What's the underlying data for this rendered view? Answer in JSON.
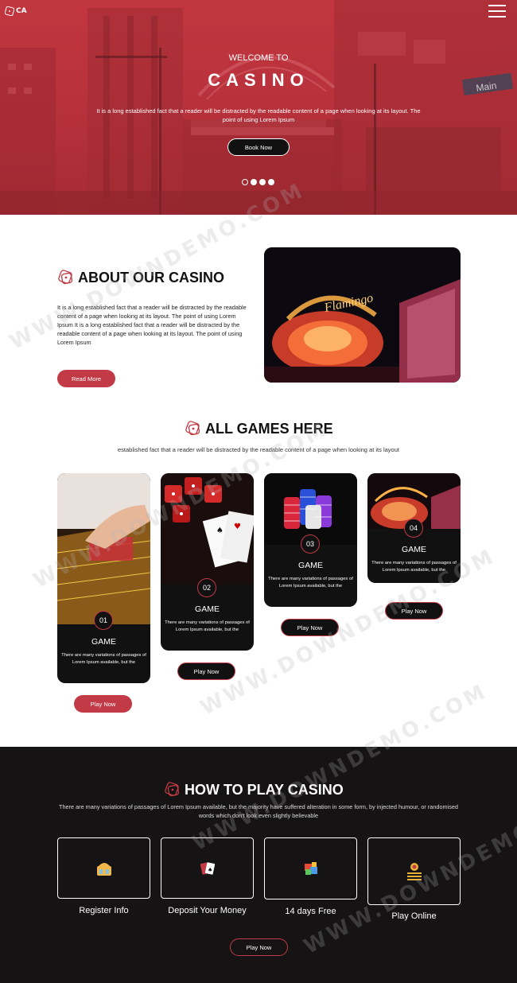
{
  "header": {
    "logo_text": "CA",
    "welcome": "WELCOME TO",
    "title": "CASINO",
    "text": "It is a long established fact that a reader will be distracted by the readable content of a page when looking at its layout. The point of using Lorem Ipsum",
    "book_button": "Book Now",
    "slides": 4,
    "active_slide": 1
  },
  "about": {
    "title": "ABOUT OUR CASINO",
    "paragraph": "It is a long established fact that a reader will be distracted by the readable content of a page when looking at its layout. The point of using Lorem Ipsum It is a long established fact that a reader will be distracted by the readable content of a page when looking at its layout. The point of using Lorem Ipsum",
    "button": "Read More"
  },
  "games": {
    "title": "ALL GAMES HERE",
    "subtitle": "established fact that a reader will be distracted by the readable content of a page when looking at its layout",
    "cards": [
      {
        "number": "01",
        "title": "GAME",
        "desc": "There are many variations of passages of Lorem Ipsum available, but the",
        "button": "Play Now"
      },
      {
        "number": "02",
        "title": "GAME",
        "desc": "There are many variations of passages of Lorem Ipsum available, but the",
        "button": "Play Now"
      },
      {
        "number": "03",
        "title": "GAME",
        "desc": "There are many variations of passages of Lorem Ipsum available, but the",
        "button": "Play Now"
      },
      {
        "number": "04",
        "title": "GAME",
        "desc": "There are many variations of passages of Lorem Ipsum available, but the",
        "button": "Play Now"
      }
    ]
  },
  "howto": {
    "title": "HOW TO PLAY CASINO",
    "subtitle": "There are many variations of passages of Lorem Ipsum available, but the majority have suffered alteration in some form, by injected humour, or randomised words which don't look even slightly believable",
    "steps": [
      {
        "label": "Register Info",
        "icon": "register-icon"
      },
      {
        "label": "Deposit Your Money",
        "icon": "cards-icon"
      },
      {
        "label": "14 days Free",
        "icon": "gift-icon"
      },
      {
        "label": "Play Online",
        "icon": "coins-icon"
      }
    ],
    "button": "Play Now"
  },
  "watermark": "WWW.DOWNDEMO.COM",
  "colors": {
    "accent": "#c13a45",
    "dark": "#151314",
    "hero": "#b5303a"
  }
}
